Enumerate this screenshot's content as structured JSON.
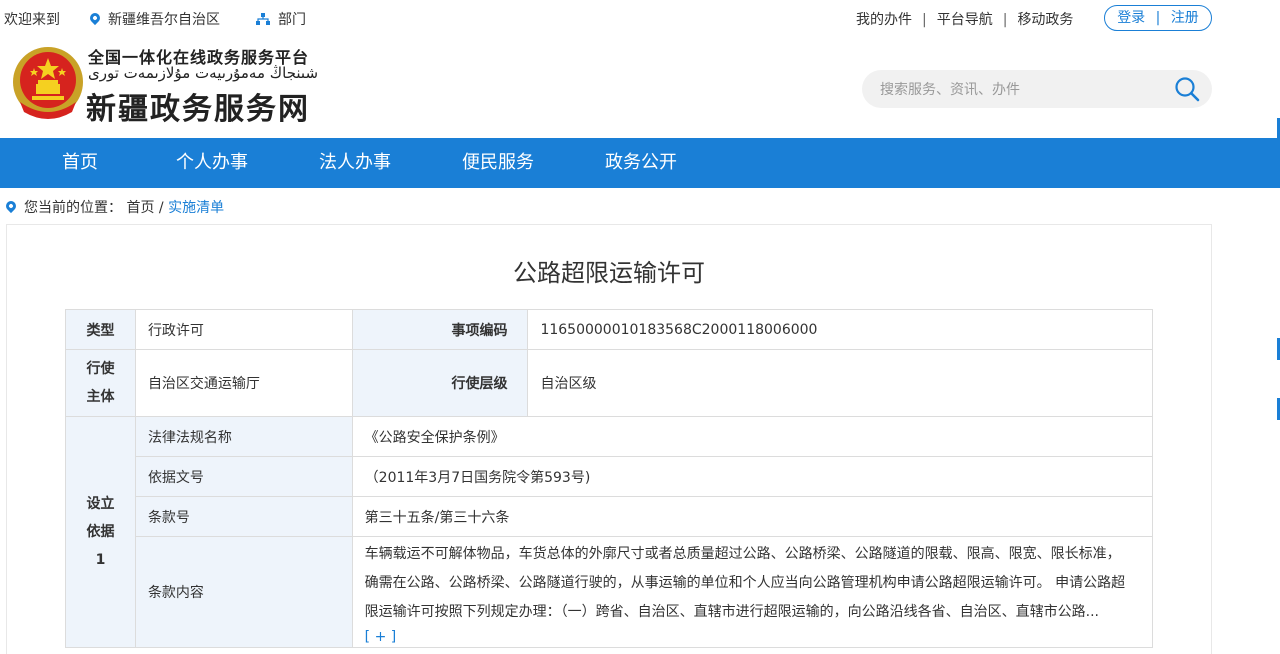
{
  "topbar": {
    "welcome": "欢迎来到",
    "region": "新疆维吾尔自治区",
    "department": "部门",
    "links": [
      "我的办件",
      "平台导航",
      "移动政务"
    ],
    "login": "登录",
    "divider": "|",
    "register": "注册"
  },
  "header": {
    "line1": "全国一体化在线政务服务平台",
    "line2": "شىنجاڭ مەمۇرىيەت مۇلازىمەت تورى",
    "line3": "新疆政务服务网",
    "search_placeholder": "搜索服务、资讯、办件"
  },
  "nav": {
    "items": [
      "首页",
      "个人办事",
      "法人办事",
      "便民服务",
      "政务公开"
    ]
  },
  "breadcrumb": {
    "prefix": "您当前的位置：",
    "home": "首页",
    "sep": " / ",
    "current": "实施清单"
  },
  "page": {
    "title": "公路超限运输许可",
    "type_label": "类型",
    "type_value": "行政许可",
    "code_label": "事项编码",
    "code_value": "11650000010183568C2000118006000",
    "subject_label_1": "行使",
    "subject_label_2": "主体",
    "subject_value": "自治区交通运输厅",
    "level_label": "行使层级",
    "level_value": "自治区级",
    "basis_label_1": "设立",
    "basis_label_2": "依据",
    "basis_label_3": "1",
    "law_label": "法律法规名称",
    "law_value": "《公路安全保护条例》",
    "doc_label": "依据文号",
    "doc_value": "（2011年3月7日国务院令第593号)",
    "article_label": "条款号",
    "article_value": "第三十五条/第三十六条",
    "content_label": "条款内容",
    "content_line1": "车辆载运不可解体物品，车货总体的外廓尺寸或者总质量超过公路、公路桥梁、公路隧道的限载、限高、限宽、限长标准，",
    "content_line2": "确需在公路、公路桥梁、公路隧道行驶的，从事运输的单位和个人应当向公路管理机构申请公路超限运输许可。 申请公路超",
    "content_line3": "限运输许可按照下列规定办理：（一）跨省、自治区、直辖市进行超限运输的，向公路沿线各省、自治区、直辖市公路...",
    "more": "[ + ]"
  },
  "colors": {
    "brand": "#1a7fd6",
    "label_bg": "#eef4fb"
  }
}
